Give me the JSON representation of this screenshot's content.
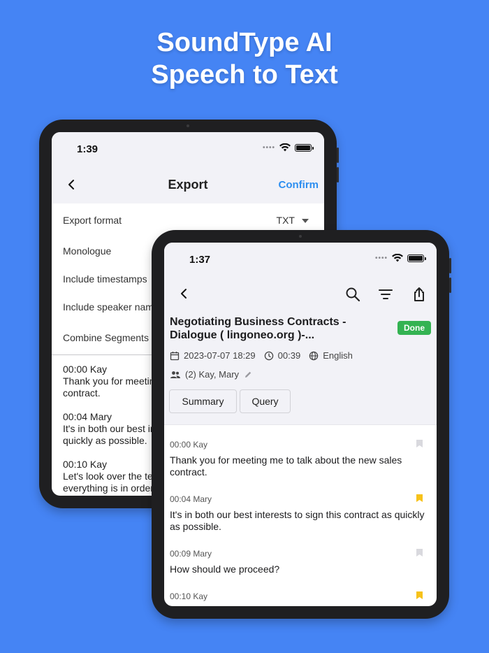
{
  "headline": {
    "line1": "SoundType AI",
    "line2": "Speech to Text"
  },
  "colors": {
    "background": "#4584f4",
    "accent": "#2d8ef0",
    "done": "#34b352",
    "bookmark_on": "#f7c21a",
    "bookmark_off": "#d9d9de"
  },
  "export_screen": {
    "time": "1:39",
    "title": "Export",
    "confirm_label": "Confirm",
    "back_icon": "chevron-left-icon",
    "options": [
      {
        "label": "Export format",
        "value": "TXT"
      },
      {
        "label": "Monologue"
      },
      {
        "label": "Include timestamps"
      },
      {
        "label": "Include speaker names"
      },
      {
        "label": "Combine Segments"
      }
    ],
    "preview": [
      {
        "header": "00:00 Kay",
        "text": [
          "Thank you for meeting me to talk about the new sales",
          "contract."
        ]
      },
      {
        "header": "00:04 Mary",
        "text": [
          "It's in both our best interests to sign this contract as",
          "quickly as possible."
        ]
      },
      {
        "header": "00:10 Kay",
        "text": [
          "Let's look over the terms to make sure",
          "everything is in order."
        ]
      }
    ]
  },
  "transcript_screen": {
    "time": "1:37",
    "back_icon": "chevron-left-icon",
    "search_icon": "search-icon",
    "filter_icon": "filter-icon",
    "share_icon": "share-icon",
    "title": "Negotiating Business Contracts - Dialogue ( lingoneo.org )-...",
    "status": "Done",
    "date": "2023-07-07 18:29",
    "duration": "00:39",
    "language": "English",
    "speakers": "(2) Kay, Mary",
    "buttons": {
      "summary": "Summary",
      "query": "Query"
    },
    "segments": [
      {
        "header": "00:00 Kay",
        "text": "Thank you for meeting me to talk about the new sales contract.",
        "bookmarked": false
      },
      {
        "header": "00:04 Mary",
        "text": "It's in both our best interests to sign this contract as quickly as possible.",
        "bookmarked": true
      },
      {
        "header": "00:09 Mary",
        "text": "How should we proceed?",
        "bookmarked": false
      },
      {
        "header": "00:10 Kay",
        "text": "",
        "bookmarked": true
      }
    ]
  }
}
